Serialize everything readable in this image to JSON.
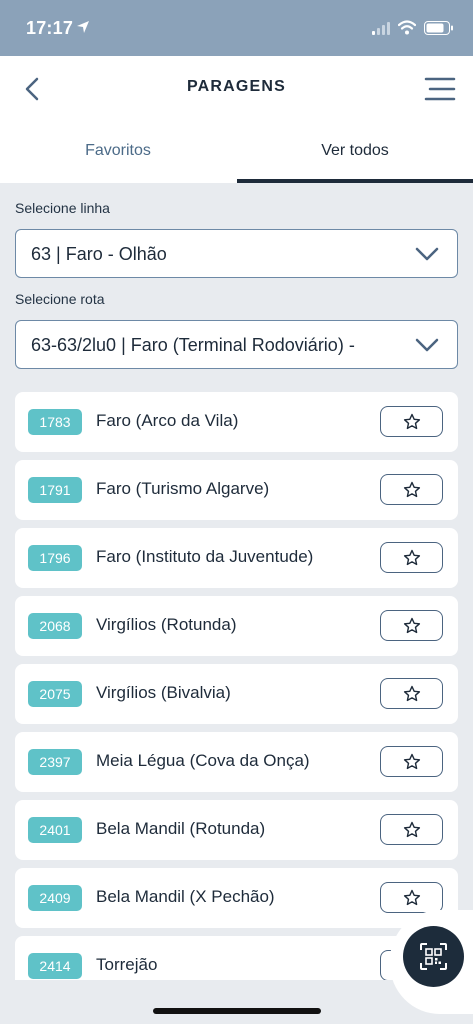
{
  "status_bar": {
    "time": "17:17",
    "location_icon": "location-arrow-icon",
    "signal_icon": "cellular-signal-icon",
    "wifi_icon": "wifi-icon",
    "battery_icon": "battery-icon"
  },
  "header": {
    "title": "PARAGENS",
    "back_icon": "chevron-left-icon",
    "menu_icon": "menu-icon"
  },
  "tabs": [
    {
      "label": "Favoritos",
      "active": false
    },
    {
      "label": "Ver todos",
      "active": true
    }
  ],
  "line_select": {
    "label": "Selecione linha",
    "value": "63 | Faro - Olhão"
  },
  "route_select": {
    "label": "Selecione rota",
    "value": "63-63/2lu0 | Faro (Terminal Rodoviário) -"
  },
  "stops": [
    {
      "code": "1783",
      "name": "Faro (Arco da Vila)"
    },
    {
      "code": "1791",
      "name": "Faro (Turismo Algarve)"
    },
    {
      "code": "1796",
      "name": "Faro (Instituto da Juventude)"
    },
    {
      "code": "2068",
      "name": "Virgílios (Rotunda)"
    },
    {
      "code": "2075",
      "name": "Virgílios (Bivalvia)"
    },
    {
      "code": "2397",
      "name": "Meia Légua (Cova da Onça)"
    },
    {
      "code": "2401",
      "name": "Bela Mandil (Rotunda)"
    },
    {
      "code": "2409",
      "name": "Bela Mandil (X Pechão)"
    },
    {
      "code": "2414",
      "name": "Torrejão"
    }
  ],
  "qr_icon": "qr-code-scan-icon",
  "colors": {
    "status_bar": "#8ba2b9",
    "accent_dark": "#1e2b3a",
    "badge": "#5fc2c8",
    "background": "#e8ebef"
  }
}
